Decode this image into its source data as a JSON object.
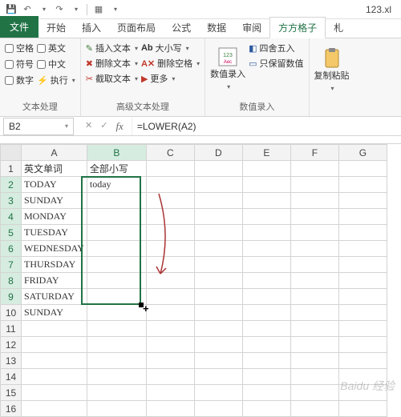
{
  "title": "123.xl",
  "tabs": {
    "file": "文件",
    "t1": "开始",
    "t2": "插入",
    "t3": "页面布局",
    "t4": "公式",
    "t5": "数据",
    "t6": "审阅",
    "active": "方方格子",
    "extra": "札"
  },
  "ribbon": {
    "g1": {
      "label": "文本处理",
      "chk": [
        "空格",
        "英文",
        "符号",
        "中文",
        "数字",
        "执行"
      ]
    },
    "g2": {
      "label": "高级文本处理",
      "col1": [
        "插入文本",
        "删除文本",
        "截取文本"
      ],
      "col2": [
        "大小写",
        "删除空格",
        "更多"
      ]
    },
    "g3": {
      "label": "数值录入",
      "big": "数值录入",
      "cmds": [
        "四舍五入",
        "只保留数值"
      ]
    },
    "g4": {
      "big": "复制粘贴"
    }
  },
  "namebox": "B2",
  "formula": "=LOWER(A2)",
  "columns": [
    "A",
    "B",
    "C",
    "D",
    "E",
    "F",
    "G"
  ],
  "rows": [
    {
      "n": "1",
      "A": "英文单词",
      "B": "全部小写"
    },
    {
      "n": "2",
      "A": "TODAY",
      "B": "today"
    },
    {
      "n": "3",
      "A": "SUNDAY",
      "B": ""
    },
    {
      "n": "4",
      "A": "MONDAY",
      "B": ""
    },
    {
      "n": "5",
      "A": "TUESDAY",
      "B": ""
    },
    {
      "n": "6",
      "A": "WEDNESDAY",
      "B": ""
    },
    {
      "n": "7",
      "A": "THURSDAY",
      "B": ""
    },
    {
      "n": "8",
      "A": "FRIDAY",
      "B": ""
    },
    {
      "n": "9",
      "A": "SATURDAY",
      "B": ""
    },
    {
      "n": "10",
      "A": "SUNDAY",
      "B": ""
    },
    {
      "n": "11",
      "A": "",
      "B": ""
    },
    {
      "n": "12",
      "A": "",
      "B": ""
    },
    {
      "n": "13",
      "A": "",
      "B": ""
    },
    {
      "n": "14",
      "A": "",
      "B": ""
    },
    {
      "n": "15",
      "A": "",
      "B": ""
    },
    {
      "n": "16",
      "A": "",
      "B": ""
    }
  ],
  "watermark": "Baidu 经验"
}
